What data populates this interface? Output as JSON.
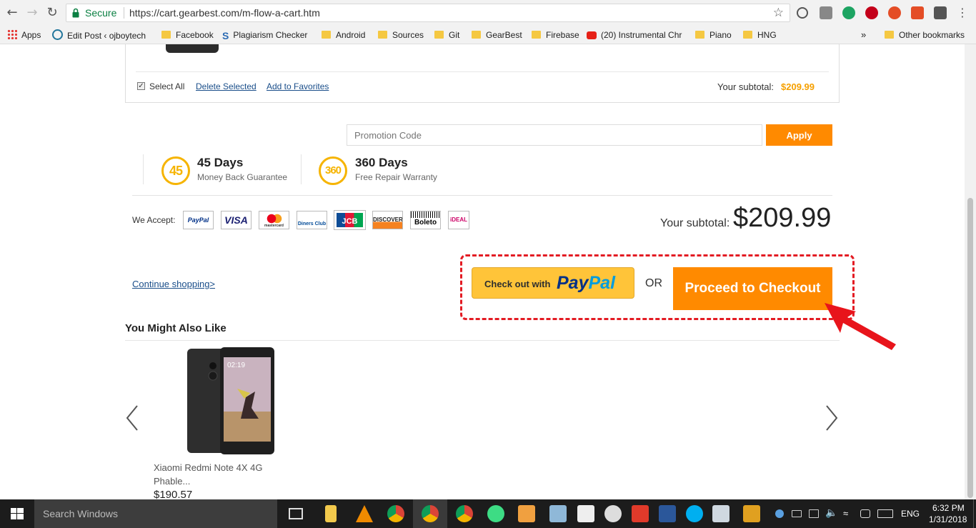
{
  "browser": {
    "secure_label": "Secure",
    "url": "https://cart.gearbest.com/m-flow-a-cart.htm",
    "bookmarks": [
      {
        "label": "Apps"
      },
      {
        "label": "Edit Post ‹ ojboytech"
      },
      {
        "label": "Facebook"
      },
      {
        "label": "Plagiarism Checker"
      },
      {
        "label": "Android"
      },
      {
        "label": "Sources"
      },
      {
        "label": "Git"
      },
      {
        "label": "GearBest"
      },
      {
        "label": "Firebase"
      },
      {
        "label": "(20) Instrumental Chr"
      },
      {
        "label": "Piano"
      },
      {
        "label": "HNG"
      }
    ],
    "more_bookmarks": "»",
    "other_bookmarks": "Other bookmarks"
  },
  "cart": {
    "select_all": "Select All",
    "delete_selected": "Delete Selected",
    "add_to_favorites": "Add to Favorites",
    "subtotal_label": "Your subtotal:",
    "subtotal_value": "$209.99"
  },
  "promo": {
    "placeholder": "Promotion Code",
    "apply": "Apply"
  },
  "guarantees": [
    {
      "badge": "45",
      "title": "45 Days",
      "subtitle": "Money Back Guarantee"
    },
    {
      "badge": "360",
      "title": "360 Days",
      "subtitle": "Free Repair Warranty"
    }
  ],
  "payments": {
    "label": "We Accept:",
    "methods": [
      "PayPal",
      "VISA",
      "mastercard",
      "Diners Club",
      "JCB",
      "DISCOVER",
      "Boleto",
      "iDEAL"
    ]
  },
  "summary": {
    "subtotal_label": "Your subtotal:",
    "subtotal_value": "$209.99"
  },
  "actions": {
    "continue_shopping": "Continue shopping>",
    "paypal_prefix": "Check out with",
    "paypal_pay": "Pay",
    "paypal_pal": "Pal",
    "or": "OR",
    "checkout": "Proceed to Checkout"
  },
  "recommendations": {
    "title": "You Might Also Like",
    "items": [
      {
        "name": "Xiaomi Redmi Note 4X 4G Phable...",
        "price": "$190.57",
        "screen_time": "02:19"
      }
    ]
  },
  "taskbar": {
    "search_placeholder": "Search Windows",
    "language": "ENG",
    "time": "6:32 PM",
    "date": "1/31/2018"
  },
  "colors": {
    "accent_orange": "#ff8a00",
    "paypal_yellow": "#ffc439",
    "badge_gold": "#f6b400",
    "highlight_red": "#e31b23"
  }
}
